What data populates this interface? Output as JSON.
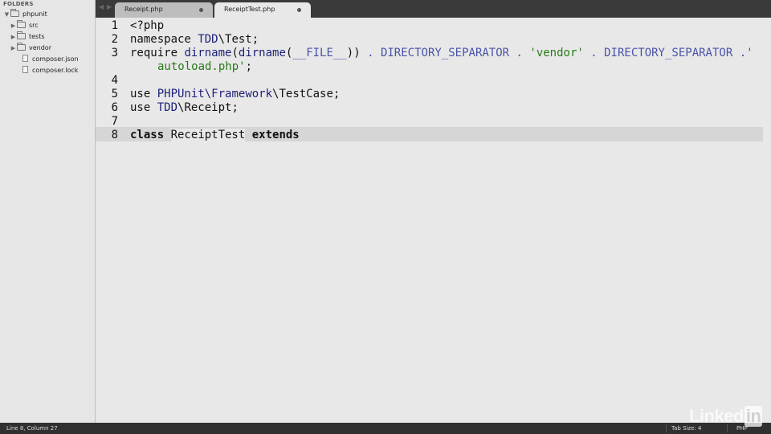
{
  "sidebar": {
    "header": "FOLDERS",
    "items": [
      {
        "label": "phpunit",
        "kind": "folder",
        "expanded": true
      },
      {
        "label": "src",
        "kind": "folder",
        "expanded": false
      },
      {
        "label": "tests",
        "kind": "folder",
        "expanded": false
      },
      {
        "label": "vendor",
        "kind": "folder",
        "expanded": false
      },
      {
        "label": "composer.json",
        "kind": "file"
      },
      {
        "label": "composer.lock",
        "kind": "file"
      }
    ]
  },
  "tabs": [
    {
      "label": "Receipt.php",
      "active": false
    },
    {
      "label": "ReceiptTest.php",
      "active": true
    }
  ],
  "editor": {
    "line_numbers": [
      "1",
      "2",
      "3",
      "4",
      "5",
      "6",
      "7",
      "8"
    ],
    "line1": {
      "t1": "<?php"
    },
    "line2": {
      "kw": "namespace ",
      "ns": "TDD",
      "rest": "\\Test;"
    },
    "line3": {
      "kw": "require ",
      "fn1": "dirname",
      "p1": "(",
      "fn2": "dirname",
      "p2": "(",
      "const1": "__FILE__",
      "p3": ")) ",
      "dot1": ". ",
      "const2": "DIRECTORY_SEPARATOR",
      "dot2": " . ",
      "str1": "'vendor'",
      "dot3": " . ",
      "const3": "DIRECTORY_SEPARATOR",
      "dot4": " .",
      "str2": "'"
    },
    "line3b": {
      "str": "autoload.php'",
      "end": ";"
    },
    "line5": {
      "kw": "use ",
      "ns1": "PHPUnit",
      "sep": "\\",
      "ns2": "Framework",
      "rest": "\\TestCase;"
    },
    "line6": {
      "kw": "use ",
      "ns": "TDD",
      "rest": "\\Receipt;"
    },
    "line8": {
      "kw": "class ",
      "name": "ReceiptTest",
      "kw2": " extends"
    }
  },
  "statusbar": {
    "position": "Line 8, Column 27",
    "tab_size": "Tab Size: 4",
    "syntax": "PHP"
  },
  "watermark": {
    "text": "Linked",
    "box": "in"
  },
  "colors": {
    "namespace": "#1d1f7a",
    "constant": "#4a53a8",
    "string": "#2a7a1a",
    "editor_bg": "#e8e8e8",
    "current_line": "#d6d6d6"
  }
}
